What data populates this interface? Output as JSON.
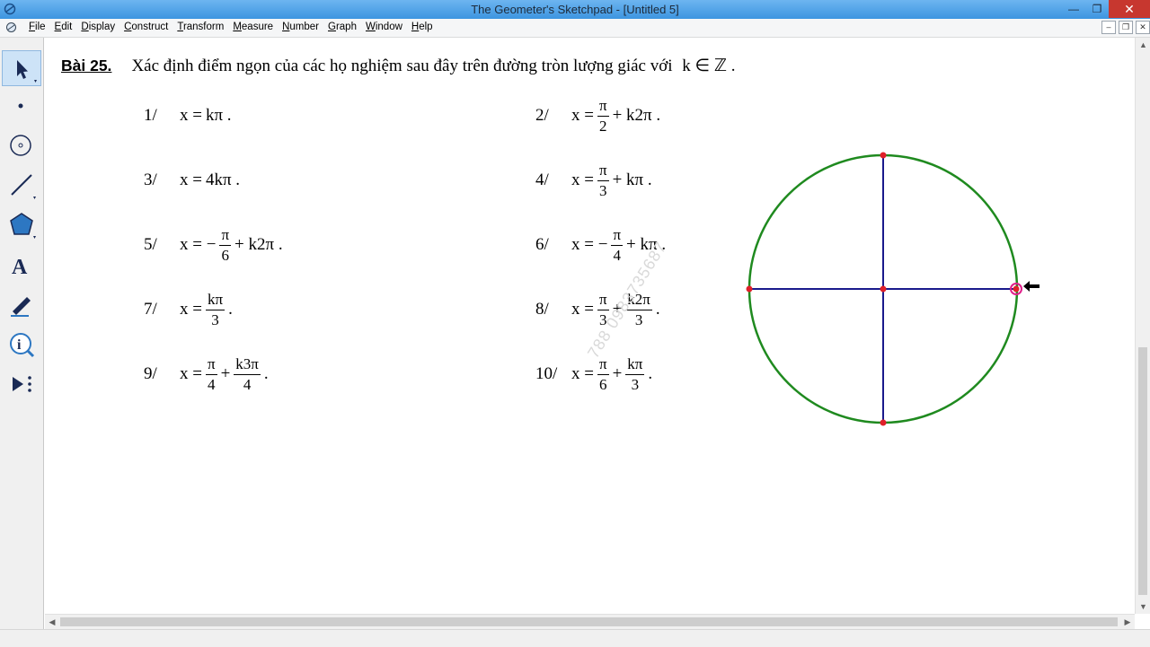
{
  "window": {
    "title": "The Geometer's Sketchpad - [Untitled 5]",
    "minimize": "—",
    "restore": "❐",
    "close": "✕"
  },
  "menu": [
    {
      "key": "F",
      "rest": "ile"
    },
    {
      "key": "E",
      "rest": "dit"
    },
    {
      "key": "D",
      "rest": "isplay"
    },
    {
      "key": "C",
      "rest": "onstruct"
    },
    {
      "key": "T",
      "rest": "ransform"
    },
    {
      "key": "M",
      "rest": "easure"
    },
    {
      "key": "N",
      "rest": "umber"
    },
    {
      "key": "G",
      "rest": "raph"
    },
    {
      "key": "W",
      "rest": "indow"
    },
    {
      "key": "H",
      "rest": "elp"
    }
  ],
  "doc_buttons": {
    "minimize": "–",
    "restore": "❐",
    "close": "✕"
  },
  "tools": [
    {
      "name": "arrow-select-tool-icon",
      "active": true
    },
    {
      "name": "point-tool-icon"
    },
    {
      "name": "compass-tool-icon"
    },
    {
      "name": "straightedge-tool-icon"
    },
    {
      "name": "polygon-tool-icon"
    },
    {
      "name": "text-tool-icon"
    },
    {
      "name": "marker-tool-icon"
    },
    {
      "name": "information-tool-icon"
    },
    {
      "name": "custom-tool-icon"
    }
  ],
  "exercise": {
    "label": "Bài 25.",
    "statement": "Xác định điểm ngọn của các họ nghiệm sau đây trên đường tròn lượng giác với",
    "condition": "k ∈ ℤ .",
    "problems": [
      {
        "num": "1/",
        "lhs": "x =",
        "parts": [
          {
            "t": "kπ ."
          }
        ]
      },
      {
        "num": "2/",
        "lhs": "x =",
        "parts": [
          {
            "n": "π",
            "d": "2"
          },
          {
            "t": "+ k2π ."
          }
        ]
      },
      {
        "num": "3/",
        "lhs": "x =",
        "parts": [
          {
            "t": "4kπ ."
          }
        ]
      },
      {
        "num": "4/",
        "lhs": "x =",
        "parts": [
          {
            "n": "π",
            "d": "3"
          },
          {
            "t": "+ kπ ."
          }
        ]
      },
      {
        "num": "5/",
        "lhs": "x = −",
        "parts": [
          {
            "n": "π",
            "d": "6"
          },
          {
            "t": "+ k2π ."
          }
        ]
      },
      {
        "num": "6/",
        "lhs": "x = −",
        "parts": [
          {
            "n": "π",
            "d": "4"
          },
          {
            "t": "+ kπ ."
          }
        ]
      },
      {
        "num": "7/",
        "lhs": "x =",
        "parts": [
          {
            "n": "kπ",
            "d": "3"
          },
          {
            "t": "."
          }
        ]
      },
      {
        "num": "8/",
        "lhs": "x =",
        "parts": [
          {
            "n": "π",
            "d": "3"
          },
          {
            "t": "+"
          },
          {
            "n": "k2π",
            "d": "3"
          },
          {
            "t": "."
          }
        ]
      },
      {
        "num": "9/",
        "lhs": "x =",
        "parts": [
          {
            "n": "π",
            "d": "4"
          },
          {
            "t": "+"
          },
          {
            "n": "k3π",
            "d": "4"
          },
          {
            "t": "."
          }
        ]
      },
      {
        "num": "10/",
        "lhs": "x =",
        "parts": [
          {
            "n": "π",
            "d": "6"
          },
          {
            "t": "+"
          },
          {
            "n": "kπ",
            "d": "3"
          },
          {
            "t": "."
          }
        ]
      }
    ]
  },
  "watermark": "788 0983735687",
  "colors": {
    "circle": "#1f8a1f",
    "axes": "#1a1a8c",
    "points": "#e0202a",
    "selected_point": "#e01f8a"
  }
}
